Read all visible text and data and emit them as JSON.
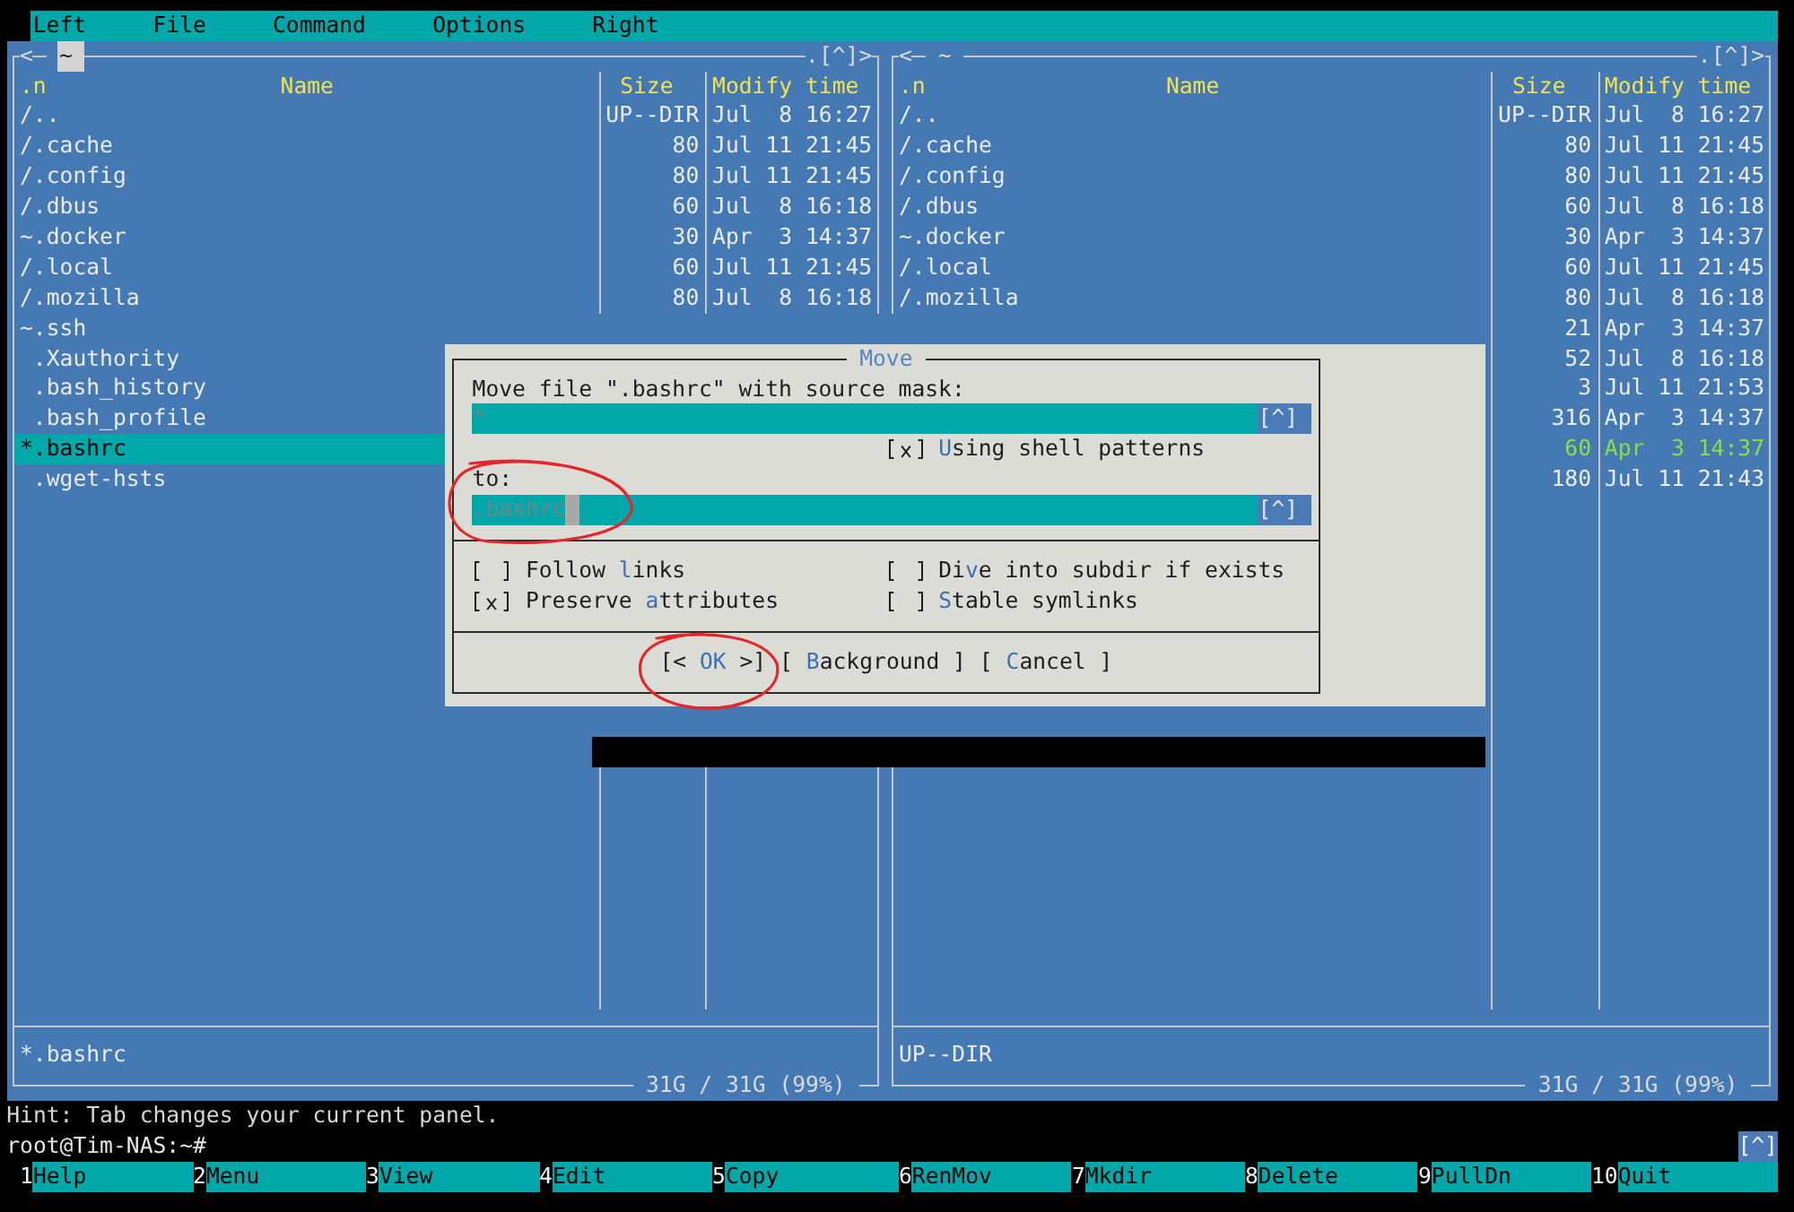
{
  "menu_bar": [
    "Left",
    "File",
    "Command",
    "Options",
    "Right"
  ],
  "panels": [
    {
      "active": true,
      "history_back": "<",
      "path": "~",
      "controls": [
        ".",
        "[^]",
        ">"
      ],
      "columns": [
        ".n",
        "Name",
        "Size",
        "Modify time"
      ],
      "rows": [
        {
          "name": "/..",
          "size": "UP--DIR",
          "modified": "Jul  8 16:27",
          "kind": "dir",
          "selected": false
        },
        {
          "name": "/.cache",
          "size": "80",
          "modified": "Jul 11 21:45",
          "kind": "dir",
          "selected": false
        },
        {
          "name": "/.config",
          "size": "80",
          "modified": "Jul 11 21:45",
          "kind": "dir",
          "selected": false
        },
        {
          "name": "/.dbus",
          "size": "60",
          "modified": "Jul  8 16:18",
          "kind": "dir",
          "selected": false
        },
        {
          "name": "~.docker",
          "size": "30",
          "modified": "Apr  3 14:37",
          "kind": "link",
          "selected": false
        },
        {
          "name": "/.local",
          "size": "60",
          "modified": "Jul 11 21:45",
          "kind": "dir",
          "selected": false
        },
        {
          "name": "/.mozilla",
          "size": "80",
          "modified": "Jul  8 16:18",
          "kind": "dir",
          "selected": false
        },
        {
          "name": "~.ssh",
          "kind": "link",
          "selected": false
        },
        {
          "name": ".Xauthority",
          "kind": "file",
          "selected": false
        },
        {
          "name": ".bash_history",
          "kind": "file",
          "selected": false
        },
        {
          "name": ".bash_profile",
          "kind": "file",
          "selected": false
        },
        {
          "name": "*.bashrc",
          "kind": "exec",
          "selected": true
        },
        {
          "name": ".wget-hsts",
          "kind": "file",
          "selected": false
        }
      ],
      "mini_status": "*.bashrc",
      "free_space": "31G / 31G (99%)"
    },
    {
      "active": false,
      "history_back": "<",
      "path": "~",
      "controls": [
        ".",
        "[^]",
        ">"
      ],
      "columns": [
        ".n",
        "Name",
        "Size",
        "Modify time"
      ],
      "rows": [
        {
          "name": "/..",
          "size": "UP--DIR",
          "modified": "Jul  8 16:27",
          "kind": "dir",
          "selected": false
        },
        {
          "name": "/.cache",
          "size": "80",
          "modified": "Jul 11 21:45",
          "kind": "dir",
          "selected": false
        },
        {
          "name": "/.config",
          "size": "80",
          "modified": "Jul 11 21:45",
          "kind": "dir",
          "selected": false
        },
        {
          "name": "/.dbus",
          "size": "60",
          "modified": "Jul  8 16:18",
          "kind": "dir",
          "selected": false
        },
        {
          "name": "~.docker",
          "size": "30",
          "modified": "Apr  3 14:37",
          "kind": "link",
          "selected": false
        },
        {
          "name": "/.local",
          "size": "60",
          "modified": "Jul 11 21:45",
          "kind": "dir",
          "selected": false
        },
        {
          "name": "/.mozilla",
          "size": "80",
          "modified": "Jul  8 16:18",
          "kind": "dir",
          "selected": false
        },
        {
          "size": "21",
          "modified": "Apr  3 14:37",
          "kind": "link",
          "selected": false
        },
        {
          "size": "52",
          "modified": "Jul  8 16:18",
          "kind": "file",
          "selected": false
        },
        {
          "size": "3",
          "modified": "Jul 11 21:53",
          "kind": "file",
          "selected": false
        },
        {
          "size": "316",
          "modified": "Apr  3 14:37",
          "kind": "file",
          "selected": false
        },
        {
          "size": "60",
          "modified": "Apr  3 14:37",
          "kind": "exec",
          "selected": false
        },
        {
          "size": "180",
          "modified": "Jul 11 21:43",
          "kind": "file",
          "selected": false
        }
      ],
      "mini_status": "UP--DIR",
      "free_space": "31G / 31G (99%)"
    }
  ],
  "dialog": {
    "title": "Move",
    "source_label": "Move file \".bashrc\" with source mask:",
    "source_field": {
      "value": "*",
      "focused": false,
      "history": "[^]"
    },
    "shell_patterns": {
      "label": "**U**sing shell patterns",
      "checked": true
    },
    "target_label": "to:",
    "target_field": {
      "value": ".bashrc",
      "focused": true,
      "history": "[^]"
    },
    "options": [
      {
        "label": "Follow **l**inks",
        "checked": false
      },
      {
        "label": "Di**v**e into subdir if exists",
        "checked": false
      },
      {
        "label": "Preserve **a**ttributes",
        "checked": true
      },
      {
        "label": "**S**table symlinks",
        "checked": false
      }
    ],
    "buttons": [
      {
        "label": "[< **OK** >]"
      },
      {
        "label": "[ **B**ackground ]"
      },
      {
        "label": "[ **C**ancel ]"
      }
    ]
  },
  "hint": "Hint: Tab changes your current panel.",
  "command_line": {
    "prompt": "root@Tim-NAS:~#",
    "history": "[^]"
  },
  "function_keys": [
    {
      "key": "1",
      "label": "Help"
    },
    {
      "key": "2",
      "label": "Menu"
    },
    {
      "key": "3",
      "label": "View"
    },
    {
      "key": "4",
      "label": "Edit"
    },
    {
      "key": "5",
      "label": "Copy"
    },
    {
      "key": "6",
      "label": "RenMov"
    },
    {
      "key": "7",
      "label": "Mkdir"
    },
    {
      "key": "8",
      "label": "Delete"
    },
    {
      "key": "9",
      "label": "PullDn"
    },
    {
      "key": "10",
      "label": "Quit"
    }
  ]
}
